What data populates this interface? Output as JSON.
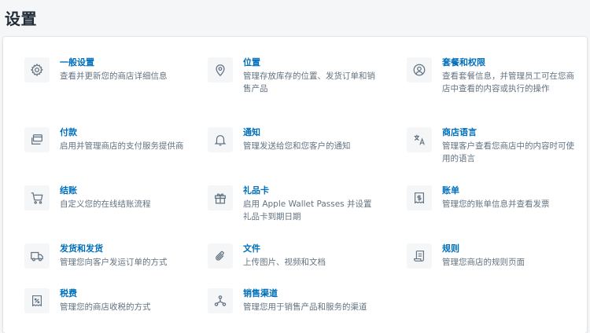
{
  "page": {
    "title": "设置"
  },
  "settings": [
    {
      "icon": "gear-icon",
      "title": "一般设置",
      "desc": "查看并更新您的商店详细信息"
    },
    {
      "icon": "location-pin-icon",
      "title": "位置",
      "desc": "管理存放库存的位置、发货订单和销售产品"
    },
    {
      "icon": "account-circle-icon",
      "title": "套餐和权限",
      "desc": "查看套餐信息，并管理员工可在您商店中查看的内容或执行的操作"
    },
    {
      "icon": "payment-cards-icon",
      "title": "付款",
      "desc": "启用并管理商店的支付服务提供商"
    },
    {
      "icon": "bell-icon",
      "title": "通知",
      "desc": "管理发送给您和您客户的通知"
    },
    {
      "icon": "translate-icon",
      "title": "商店语言",
      "desc": "管理客户查看您商店中的内容时可使用的语言"
    },
    {
      "icon": "cart-icon",
      "title": "结账",
      "desc": "自定义您的在线结账流程"
    },
    {
      "icon": "gift-icon",
      "title": "礼品卡",
      "desc": "启用 Apple Wallet Passes 并设置礼品卡到期日期"
    },
    {
      "icon": "billing-icon",
      "title": "账单",
      "desc": "管理您的账单信息并查看发票"
    },
    {
      "icon": "truck-icon",
      "title": "发货和发货",
      "desc": "管理您向客户发运订单的方式"
    },
    {
      "icon": "paperclip-icon",
      "title": "文件",
      "desc": "上传图片、视频和文档"
    },
    {
      "icon": "legal-scroll-icon",
      "title": "规则",
      "desc": "管理您商店的规则页面"
    },
    {
      "icon": "tax-receipt-icon",
      "title": "税费",
      "desc": "管理您的商店收税的方式"
    },
    {
      "icon": "channels-icon",
      "title": "销售渠道",
      "desc": "管理您用于销售产品和服务的渠道"
    }
  ]
}
